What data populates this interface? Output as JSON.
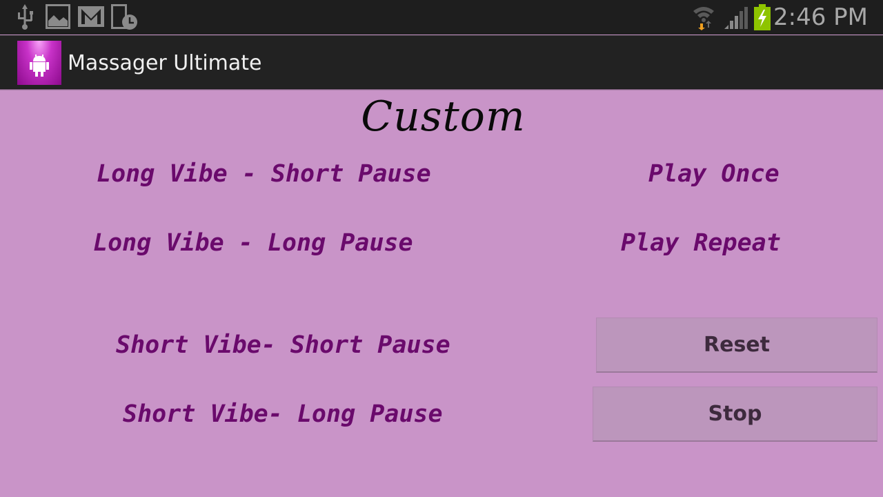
{
  "status_bar": {
    "left_icons": [
      "usb-icon",
      "image-icon",
      "gmail-icon",
      "phone-clock-icon"
    ],
    "right_icons": [
      "wifi-icon",
      "signal-icon",
      "battery-charging-icon"
    ],
    "time": "2:46 PM",
    "battery_color": "#8ec400"
  },
  "action_bar": {
    "app_icon": "android-icon",
    "title": "Massager Ultimate"
  },
  "main": {
    "heading": "Custom",
    "patterns": [
      {
        "label": "Long Vibe - Short Pause"
      },
      {
        "label": "Long Vibe - Long Pause"
      },
      {
        "label": "Short Vibe- Short Pause"
      },
      {
        "label": "Short Vibe- Long Pause"
      }
    ],
    "play_options": [
      {
        "label": "Play Once"
      },
      {
        "label": "Play Repeat"
      }
    ],
    "buttons": {
      "reset": "Reset",
      "stop": "Stop"
    },
    "colors": {
      "background": "#c994c8",
      "option_text": "#6a0a6c",
      "button_bg": "#bc96bc"
    }
  }
}
